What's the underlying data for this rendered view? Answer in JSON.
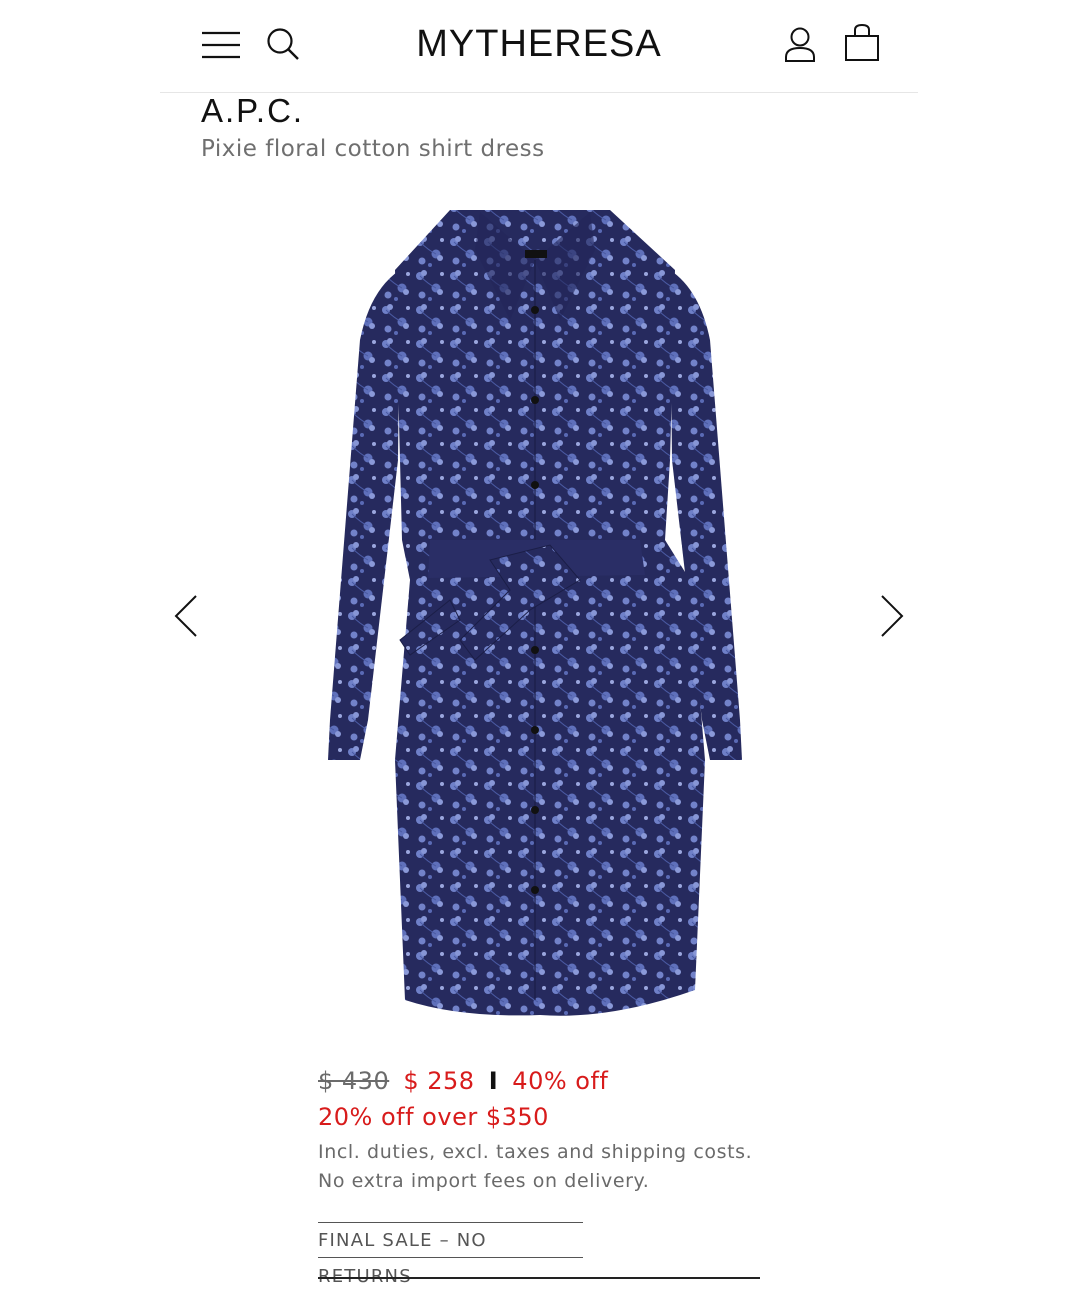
{
  "header": {
    "logo": "MYTHERESA",
    "icons": [
      "menu-icon",
      "search-icon",
      "account-icon",
      "shopping-bag-icon"
    ]
  },
  "product": {
    "brand": "A.P.C.",
    "name": "Pixie floral cotton shirt dress",
    "image_description_icon": "dress-image",
    "colors": {
      "dress": "#2c2f6b",
      "print": "#6f80c8"
    }
  },
  "gallery": {
    "prev_icon": "chevron-left-icon",
    "next_icon": "chevron-right-icon"
  },
  "pricing": {
    "original": "$ 430",
    "sale": "$ 258",
    "separator": "I",
    "discount": "40% off",
    "promo": "20% off over $350",
    "info_line1": "Incl. duties, excl. taxes and shipping costs.",
    "info_line2": "No extra import fees on delivery.",
    "final_sale": "FINAL SALE – NO RETURNS",
    "sale_color": "#d81b1b"
  }
}
